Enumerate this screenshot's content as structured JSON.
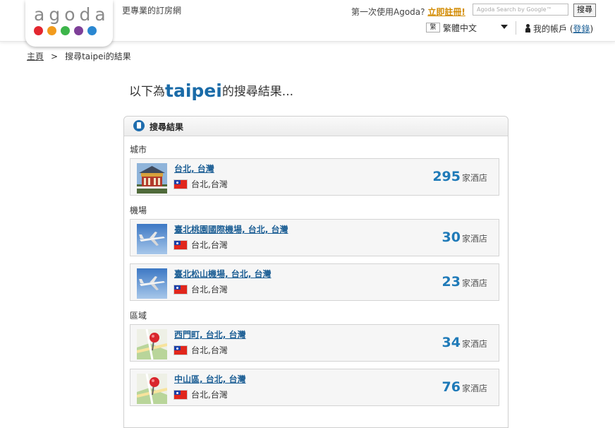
{
  "header": {
    "logo_text": "agoda",
    "logo_dot_colors": [
      "#e3262f",
      "#f29b1d",
      "#3db54a",
      "#7e3f98",
      "#2a87d1"
    ],
    "tagline": "更專業的訂房網",
    "first_time_text": "第一次使用Agoda?",
    "first_time_link": "立即註冊!",
    "search_placeholder": "Agoda Search by Google™",
    "search_button": "搜尋",
    "language_icon": "繁",
    "language": "繁體中文",
    "account_label": "我的帳戶",
    "login_open": "(",
    "login_link": "登錄",
    "login_close": ")"
  },
  "breadcrumb": {
    "home": "主頁",
    "separator": ">",
    "current": "搜尋taipei的結果"
  },
  "heading": {
    "prefix": "以下為",
    "query": "taipei",
    "suffix": "的搜尋結果..."
  },
  "results": {
    "title": "搜尋結果",
    "hotel_unit": "家酒店",
    "sections": [
      {
        "label": "城市",
        "items": [
          {
            "name": "台北, 台灣",
            "location": "台北,台灣",
            "count": "295",
            "thumb": "city-building-thumbnail"
          }
        ]
      },
      {
        "label": "機場",
        "items": [
          {
            "name": "臺北桃園國際機場, 台北, 台灣",
            "location": "台北,台灣",
            "count": "30",
            "thumb": "airplane-thumbnail"
          },
          {
            "name": "臺北松山機場, 台北, 台灣",
            "location": "台北,台灣",
            "count": "23",
            "thumb": "airplane-thumbnail"
          }
        ]
      },
      {
        "label": "區域",
        "items": [
          {
            "name": "西門町, 台北, 台灣",
            "location": "台北,台灣",
            "count": "34",
            "thumb": "map-pin-thumbnail"
          },
          {
            "name": "中山區, 台北, 台灣",
            "location": "台北,台灣",
            "count": "76",
            "thumb": "map-pin-thumbnail"
          }
        ]
      }
    ]
  },
  "icons": {
    "flag": "taiwan-flag-icon",
    "document": "document-icon",
    "user": "user-icon",
    "dropdown": "chevron-down-icon"
  }
}
